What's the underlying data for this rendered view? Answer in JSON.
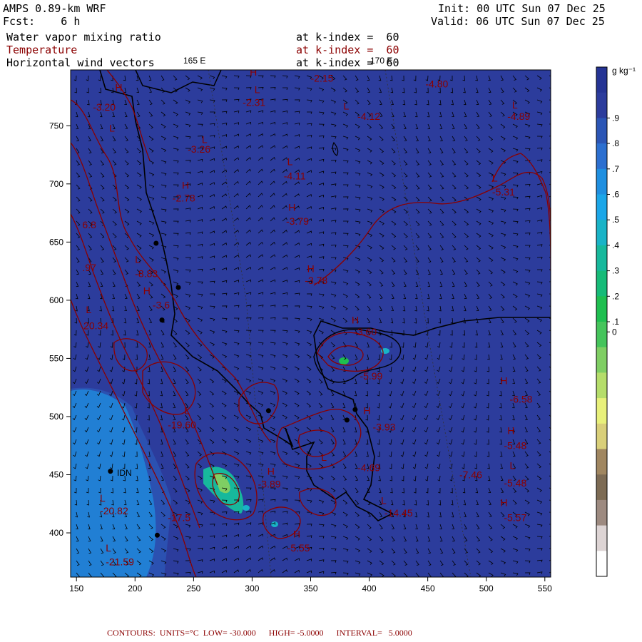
{
  "header": {
    "model": "AMPS 0.89-km WRF",
    "forecast": "Fcst:    6 h",
    "init": "Init: 00 UTC Sun 07 Dec 25",
    "valid": "Valid: 06 UTC Sun 07 Dec 25",
    "field1": "Water vapor mixing ratio",
    "field2": "Temperature",
    "field3": "Horizontal wind vectors",
    "level1": "at k-index =  60",
    "level2": "at k-index =  60",
    "level3": "at k-index =  60"
  },
  "lon_labels": [
    "165 E",
    "170 E"
  ],
  "station_label": "IDN",
  "colorbar": {
    "unit": "g kg⁻¹",
    "labels": [
      ".9",
      ".8",
      ".7",
      ".6",
      ".5",
      ".4",
      ".3",
      ".2",
      ".1",
      "0"
    ],
    "colors": [
      "#253494",
      "#2c3c9c",
      "#2b55b5",
      "#2c6fd0",
      "#1f8fe0",
      "#1ba6e8",
      "#19b3c7",
      "#17b89c",
      "#16bb78",
      "#1fbf50",
      "#45c45b",
      "#7fce63",
      "#b5dd6a",
      "#e8f07a",
      "#d9cf79",
      "#a08660",
      "#7d6b54",
      "#9d8a80",
      "#ddd4d4",
      "#ffffff"
    ]
  },
  "chart_data": {
    "type": "heatmap",
    "title": "",
    "xlabel": "",
    "ylabel": "",
    "xlim": [
      145,
      555
    ],
    "ylim": [
      362,
      798
    ],
    "x_ticks": [
      150,
      200,
      250,
      300,
      350,
      400,
      450,
      500,
      550
    ],
    "y_ticks": [
      400,
      450,
      500,
      550,
      600,
      650,
      700,
      750
    ],
    "temperature_labels": [
      {
        "text": "-2.15",
        "x": 350,
        "y": 788
      },
      {
        "text": "-4.80",
        "x": 448,
        "y": 783
      },
      {
        "text": "-2.31",
        "x": 292,
        "y": 767
      },
      {
        "text": "-3.20",
        "x": 164,
        "y": 763
      },
      {
        "text": "-4.12",
        "x": 390,
        "y": 755
      },
      {
        "text": "-4.89",
        "x": 518,
        "y": 755
      },
      {
        "text": "-3.26",
        "x": 245,
        "y": 727
      },
      {
        "text": "-4.11",
        "x": 327,
        "y": 704
      },
      {
        "text": "-5.31",
        "x": 505,
        "y": 690
      },
      {
        "text": "-2.78",
        "x": 232,
        "y": 685
      },
      {
        "text": "-3.79",
        "x": 329,
        "y": 665
      },
      {
        "text": "6.8",
        "x": 155,
        "y": 662
      },
      {
        "text": ".97",
        "x": 155,
        "y": 625
      },
      {
        "text": "-8.83",
        "x": 200,
        "y": 620
      },
      {
        "text": "-3.78",
        "x": 345,
        "y": 614
      },
      {
        "text": "-3.6",
        "x": 215,
        "y": 593
      },
      {
        "text": "20.34",
        "x": 156,
        "y": 575
      },
      {
        "text": "-3.60",
        "x": 387,
        "y": 570
      },
      {
        "text": "-5.99",
        "x": 392,
        "y": 532
      },
      {
        "text": "-6.58",
        "x": 520,
        "y": 512
      },
      {
        "text": "-19.60",
        "x": 228,
        "y": 490
      },
      {
        "text": "-3.93",
        "x": 403,
        "y": 488
      },
      {
        "text": "-5.48",
        "x": 515,
        "y": 472
      },
      {
        "text": "-4.69",
        "x": 390,
        "y": 453
      },
      {
        "text": "-7.46",
        "x": 477,
        "y": 447
      },
      {
        "text": "-5.48",
        "x": 515,
        "y": 440
      },
      {
        "text": "-3.89",
        "x": 305,
        "y": 439
      },
      {
        "text": "-20.82",
        "x": 170,
        "y": 416
      },
      {
        "text": "-17.5",
        "x": 228,
        "y": 410
      },
      {
        "text": "-14.45",
        "x": 413,
        "y": 414
      },
      {
        "text": "-5.57",
        "x": 515,
        "y": 410
      },
      {
        "text": "-5.55",
        "x": 330,
        "y": 384
      },
      {
        "text": "-21.59",
        "x": 175,
        "y": 372
      }
    ],
    "hl_labels": [
      {
        "text": "H",
        "x": 298,
        "y": 793
      },
      {
        "text": "H",
        "x": 183,
        "y": 780
      },
      {
        "text": "L",
        "x": 302,
        "y": 778
      },
      {
        "text": "L",
        "x": 378,
        "y": 764
      },
      {
        "text": "L",
        "x": 522,
        "y": 765
      },
      {
        "text": "L",
        "x": 257,
        "y": 735
      },
      {
        "text": "L",
        "x": 178,
        "y": 745
      },
      {
        "text": "L",
        "x": 330,
        "y": 716
      },
      {
        "text": "L",
        "x": 505,
        "y": 702
      },
      {
        "text": "H",
        "x": 240,
        "y": 696
      },
      {
        "text": "H",
        "x": 331,
        "y": 677
      },
      {
        "text": "L",
        "x": 200,
        "y": 632
      },
      {
        "text": "H",
        "x": 347,
        "y": 624
      },
      {
        "text": "H",
        "x": 207,
        "y": 605
      },
      {
        "text": "L",
        "x": 158,
        "y": 589
      },
      {
        "text": "H",
        "x": 385,
        "y": 580
      },
      {
        "text": "H",
        "x": 512,
        "y": 528
      },
      {
        "text": "L",
        "x": 242,
        "y": 502
      },
      {
        "text": "H",
        "x": 518,
        "y": 485
      },
      {
        "text": "L",
        "x": 520,
        "y": 455
      },
      {
        "text": "H",
        "x": 395,
        "y": 502
      },
      {
        "text": "L",
        "x": 359,
        "y": 462
      },
      {
        "text": "H",
        "x": 313,
        "y": 450
      },
      {
        "text": "H",
        "x": 512,
        "y": 423
      },
      {
        "text": "L",
        "x": 410,
        "y": 425
      },
      {
        "text": "L",
        "x": 170,
        "y": 427
      },
      {
        "text": "H",
        "x": 335,
        "y": 396
      },
      {
        "text": "L",
        "x": 175,
        "y": 384
      }
    ],
    "stations": [
      {
        "x": 218,
        "y": 649
      },
      {
        "x": 237,
        "y": 611
      },
      {
        "x": 223,
        "y": 583
      },
      {
        "x": 314,
        "y": 505
      },
      {
        "x": 388,
        "y": 506
      },
      {
        "x": 381,
        "y": 497
      },
      {
        "x": 179,
        "y": 453
      },
      {
        "x": 219,
        "y": 398
      }
    ]
  },
  "footer": {
    "contours": "CONTOURS:  UNITS=°C  LOW= -30.000      HIGH= -5.0000      INTERVAL=   5.0000"
  }
}
